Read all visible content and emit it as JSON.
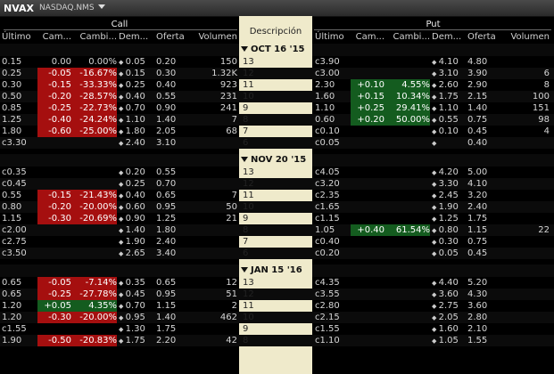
{
  "window": {
    "symbol": "NVAX",
    "exchange": "NASDAQ.NMS"
  },
  "headers": {
    "call": "Call",
    "put": "Put",
    "description": "Descripción",
    "columns": [
      "Último",
      "Cam...",
      "Cambi...",
      "Dem...",
      "Oferta",
      "Volumen"
    ]
  },
  "expiries": [
    {
      "label": "OCT 16 '15",
      "rows": [
        {
          "strike": "13",
          "call": {
            "last": "0.15",
            "chg": "0.00",
            "pct": "0.00%",
            "bid": "0.05",
            "ask": "0.20",
            "vol": "150",
            "tone": ""
          },
          "put": {
            "last": "c3.90",
            "chg": "",
            "pct": "",
            "bid": "4.10",
            "ask": "4.80",
            "vol": "",
            "tone": ""
          }
        },
        {
          "strike": "12",
          "call": {
            "last": "0.25",
            "chg": "-0.05",
            "pct": "-16.67%",
            "bid": "0.15",
            "ask": "0.30",
            "vol": "1.32K",
            "tone": "neg"
          },
          "put": {
            "last": "c3.00",
            "chg": "",
            "pct": "",
            "bid": "3.10",
            "ask": "3.90",
            "vol": "6",
            "tone": ""
          }
        },
        {
          "strike": "11",
          "call": {
            "last": "0.30",
            "chg": "-0.15",
            "pct": "-33.33%",
            "bid": "0.25",
            "ask": "0.40",
            "vol": "923",
            "tone": "neg"
          },
          "put": {
            "last": "2.30",
            "chg": "+0.10",
            "pct": "4.55%",
            "bid": "2.60",
            "ask": "2.90",
            "vol": "8",
            "tone": "pos"
          }
        },
        {
          "strike": "10",
          "call": {
            "last": "0.50",
            "chg": "-0.20",
            "pct": "-28.57%",
            "bid": "0.40",
            "ask": "0.55",
            "vol": "231",
            "tone": "neg"
          },
          "put": {
            "last": "1.60",
            "chg": "+0.15",
            "pct": "10.34%",
            "bid": "1.75",
            "ask": "2.15",
            "vol": "100",
            "tone": "pos"
          }
        },
        {
          "strike": "9",
          "call": {
            "last": "0.85",
            "chg": "-0.25",
            "pct": "-22.73%",
            "bid": "0.70",
            "ask": "0.90",
            "vol": "241",
            "tone": "neg"
          },
          "put": {
            "last": "1.10",
            "chg": "+0.25",
            "pct": "29.41%",
            "bid": "1.10",
            "ask": "1.40",
            "vol": "151",
            "tone": "pos"
          }
        },
        {
          "strike": "8",
          "call": {
            "last": "1.25",
            "chg": "-0.40",
            "pct": "-24.24%",
            "bid": "1.10",
            "ask": "1.40",
            "vol": "7",
            "tone": "neg"
          },
          "put": {
            "last": "0.60",
            "chg": "+0.20",
            "pct": "50.00%",
            "bid": "0.55",
            "ask": "0.75",
            "vol": "98",
            "tone": "pos"
          }
        },
        {
          "strike": "7",
          "call": {
            "last": "1.80",
            "chg": "-0.60",
            "pct": "-25.00%",
            "bid": "1.80",
            "ask": "2.05",
            "vol": "68",
            "tone": "neg"
          },
          "put": {
            "last": "c0.10",
            "chg": "",
            "pct": "",
            "bid": "0.10",
            "ask": "0.45",
            "vol": "4",
            "tone": ""
          }
        },
        {
          "strike": "6",
          "call": {
            "last": "c3.30",
            "chg": "",
            "pct": "",
            "bid": "2.40",
            "ask": "3.10",
            "vol": "",
            "tone": ""
          },
          "put": {
            "last": "c0.05",
            "chg": "",
            "pct": "",
            "bid": "",
            "ask": "0.40",
            "vol": "",
            "tone": ""
          }
        }
      ]
    },
    {
      "label": "NOV 20 '15",
      "rows": [
        {
          "strike": "13",
          "call": {
            "last": "c0.35",
            "chg": "",
            "pct": "",
            "bid": "0.20",
            "ask": "0.55",
            "vol": "",
            "tone": ""
          },
          "put": {
            "last": "c4.05",
            "chg": "",
            "pct": "",
            "bid": "4.20",
            "ask": "5.00",
            "vol": "",
            "tone": ""
          }
        },
        {
          "strike": "12",
          "call": {
            "last": "c0.45",
            "chg": "",
            "pct": "",
            "bid": "0.25",
            "ask": "0.70",
            "vol": "",
            "tone": ""
          },
          "put": {
            "last": "c3.20",
            "chg": "",
            "pct": "",
            "bid": "3.30",
            "ask": "4.10",
            "vol": "",
            "tone": ""
          }
        },
        {
          "strike": "11",
          "call": {
            "last": "0.55",
            "chg": "-0.15",
            "pct": "-21.43%",
            "bid": "0.40",
            "ask": "0.65",
            "vol": "7",
            "tone": "neg"
          },
          "put": {
            "last": "c2.35",
            "chg": "",
            "pct": "",
            "bid": "2.45",
            "ask": "3.20",
            "vol": "",
            "tone": ""
          }
        },
        {
          "strike": "10",
          "call": {
            "last": "0.80",
            "chg": "-0.20",
            "pct": "-20.00%",
            "bid": "0.60",
            "ask": "0.95",
            "vol": "50",
            "tone": "neg"
          },
          "put": {
            "last": "c1.65",
            "chg": "",
            "pct": "",
            "bid": "1.90",
            "ask": "2.40",
            "vol": "",
            "tone": ""
          }
        },
        {
          "strike": "9",
          "call": {
            "last": "1.15",
            "chg": "-0.30",
            "pct": "-20.69%",
            "bid": "0.90",
            "ask": "1.25",
            "vol": "21",
            "tone": "neg"
          },
          "put": {
            "last": "c1.15",
            "chg": "",
            "pct": "",
            "bid": "1.25",
            "ask": "1.75",
            "vol": "",
            "tone": ""
          }
        },
        {
          "strike": "8",
          "call": {
            "last": "c2.00",
            "chg": "",
            "pct": "",
            "bid": "1.40",
            "ask": "1.80",
            "vol": "",
            "tone": ""
          },
          "put": {
            "last": "1.05",
            "chg": "+0.40",
            "pct": "61.54%",
            "bid": "0.80",
            "ask": "1.15",
            "vol": "22",
            "tone": "pos"
          }
        },
        {
          "strike": "7",
          "call": {
            "last": "c2.75",
            "chg": "",
            "pct": "",
            "bid": "1.90",
            "ask": "2.40",
            "vol": "",
            "tone": ""
          },
          "put": {
            "last": "c0.40",
            "chg": "",
            "pct": "",
            "bid": "0.30",
            "ask": "0.75",
            "vol": "",
            "tone": ""
          }
        },
        {
          "strike": "6",
          "call": {
            "last": "c3.50",
            "chg": "",
            "pct": "",
            "bid": "2.65",
            "ask": "3.40",
            "vol": "",
            "tone": ""
          },
          "put": {
            "last": "c0.20",
            "chg": "",
            "pct": "",
            "bid": "0.05",
            "ask": "0.45",
            "vol": "",
            "tone": ""
          }
        }
      ]
    },
    {
      "label": "JAN 15 '16",
      "rows": [
        {
          "strike": "13",
          "call": {
            "last": "0.65",
            "chg": "-0.05",
            "pct": "-7.14%",
            "bid": "0.35",
            "ask": "0.65",
            "vol": "12",
            "tone": "neg"
          },
          "put": {
            "last": "c4.35",
            "chg": "",
            "pct": "",
            "bid": "4.40",
            "ask": "5.20",
            "vol": "",
            "tone": ""
          }
        },
        {
          "strike": "12",
          "call": {
            "last": "0.65",
            "chg": "-0.25",
            "pct": "-27.78%",
            "bid": "0.45",
            "ask": "0.95",
            "vol": "51",
            "tone": "neg"
          },
          "put": {
            "last": "c3.55",
            "chg": "",
            "pct": "",
            "bid": "3.60",
            "ask": "4.30",
            "vol": "",
            "tone": ""
          }
        },
        {
          "strike": "11",
          "call": {
            "last": "1.20",
            "chg": "+0.05",
            "pct": "4.35%",
            "bid": "0.70",
            "ask": "1.15",
            "vol": "2",
            "tone": "pos"
          },
          "put": {
            "last": "c2.80",
            "chg": "",
            "pct": "",
            "bid": "2.75",
            "ask": "3.60",
            "vol": "",
            "tone": ""
          }
        },
        {
          "strike": "10",
          "call": {
            "last": "1.20",
            "chg": "-0.30",
            "pct": "-20.00%",
            "bid": "0.95",
            "ask": "1.40",
            "vol": "462",
            "tone": "neg"
          },
          "put": {
            "last": "c2.15",
            "chg": "",
            "pct": "",
            "bid": "2.05",
            "ask": "2.80",
            "vol": "",
            "tone": ""
          }
        },
        {
          "strike": "9",
          "call": {
            "last": "c1.55",
            "chg": "",
            "pct": "",
            "bid": "1.30",
            "ask": "1.75",
            "vol": "",
            "tone": ""
          },
          "put": {
            "last": "c1.55",
            "chg": "",
            "pct": "",
            "bid": "1.60",
            "ask": "2.10",
            "vol": "",
            "tone": ""
          }
        },
        {
          "strike": "8",
          "call": {
            "last": "1.90",
            "chg": "-0.50",
            "pct": "-20.83%",
            "bid": "1.75",
            "ask": "2.20",
            "vol": "42",
            "tone": "neg"
          },
          "put": {
            "last": "c1.10",
            "chg": "",
            "pct": "",
            "bid": "1.05",
            "ask": "1.55",
            "vol": "",
            "tone": ""
          }
        }
      ]
    }
  ],
  "colors": {
    "negative": "#a50f0f",
    "positive": "#145c1f",
    "description_bg": "#efeacb"
  }
}
